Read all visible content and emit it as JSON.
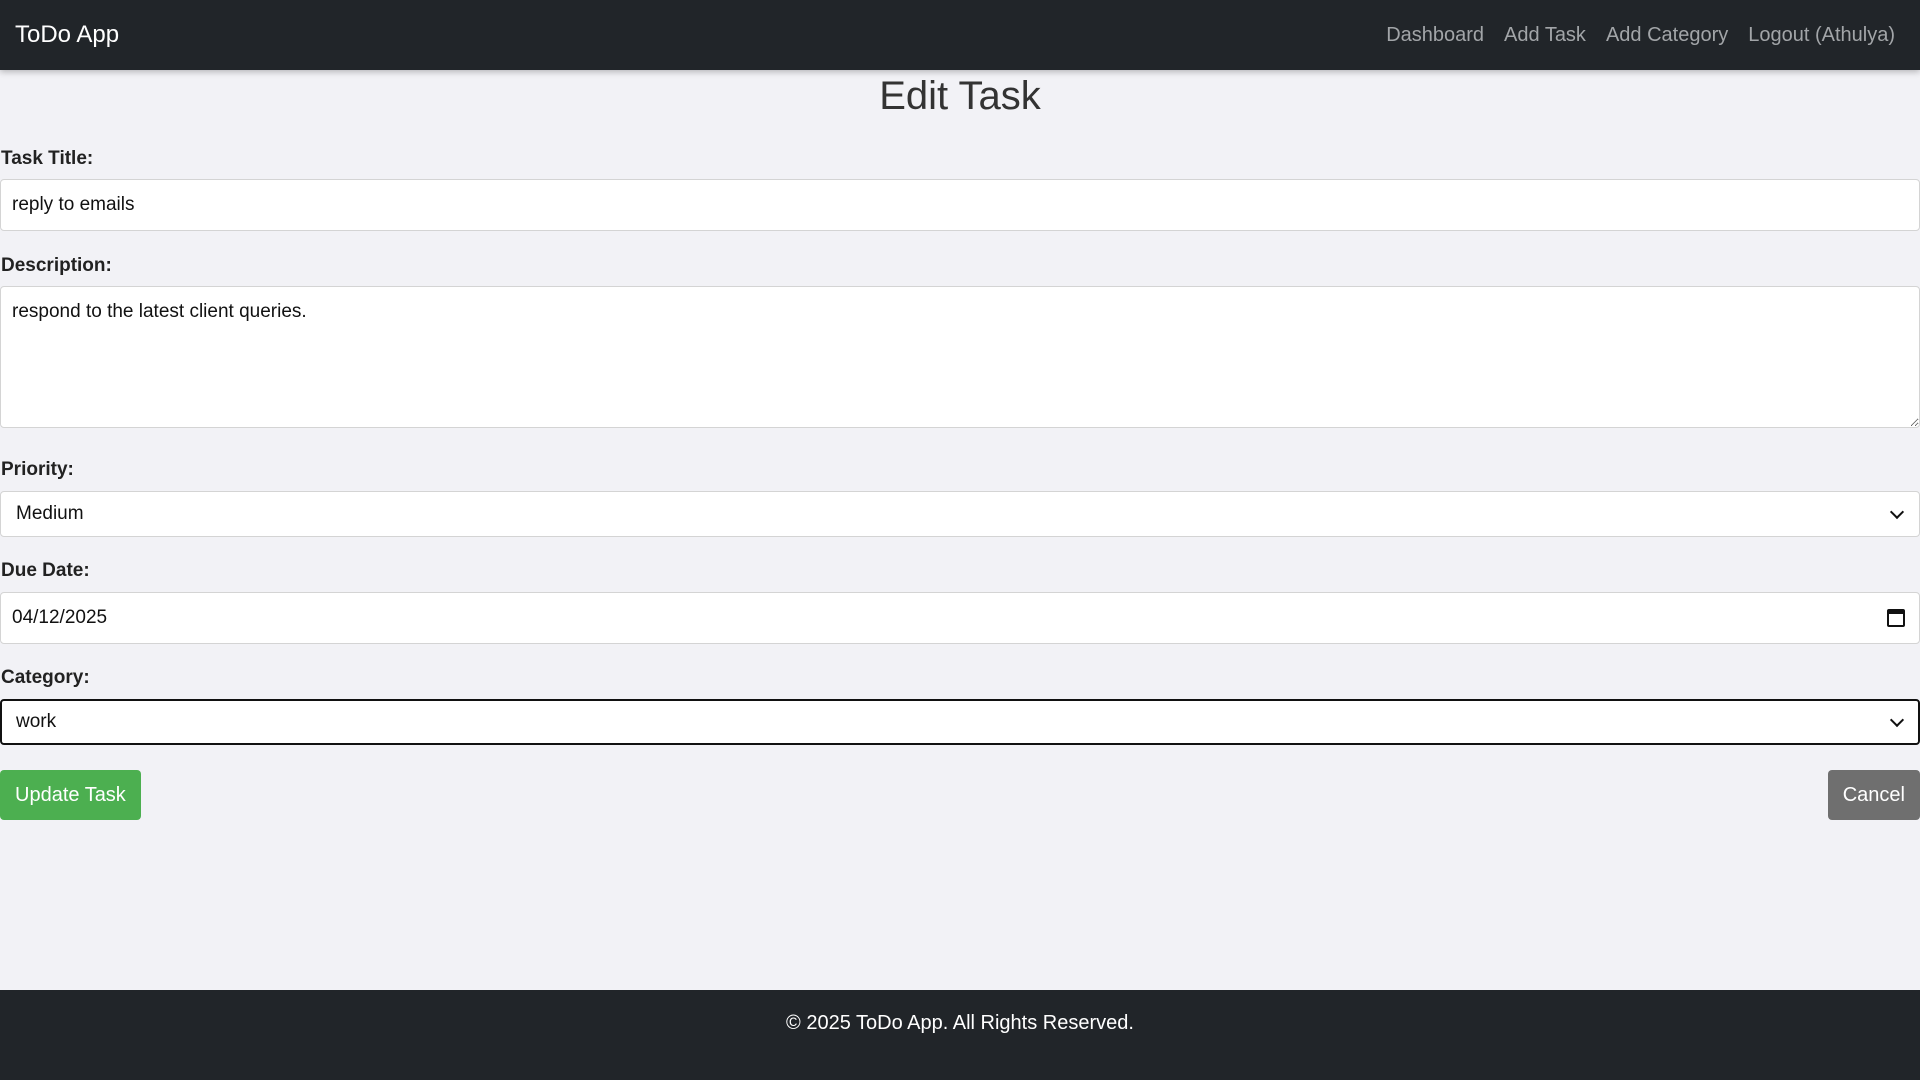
{
  "navbar": {
    "brand": "ToDo App",
    "links": [
      {
        "label": "Dashboard"
      },
      {
        "label": "Add Task"
      },
      {
        "label": "Add Category"
      },
      {
        "label": "Logout (Athulya)"
      }
    ]
  },
  "form": {
    "title": "Edit Task",
    "task_title": {
      "label": "Task Title:",
      "value": "reply to emails"
    },
    "description": {
      "label": "Description:",
      "value": "respond to the latest client queries."
    },
    "priority": {
      "label": "Priority:",
      "selected": "Medium"
    },
    "due_date": {
      "label": "Due Date:",
      "value": "04/12/2025"
    },
    "category": {
      "label": "Category:",
      "selected": "work"
    },
    "update_button": "Update Task",
    "cancel_button": "Cancel"
  },
  "footer": {
    "text": "© 2025 ToDo App. All Rights Reserved."
  },
  "colors": {
    "navbar_bg": "#212529",
    "page_bg": "#f2f2f6",
    "update_button": "#4caf50",
    "cancel_button": "#6f6f6f"
  }
}
